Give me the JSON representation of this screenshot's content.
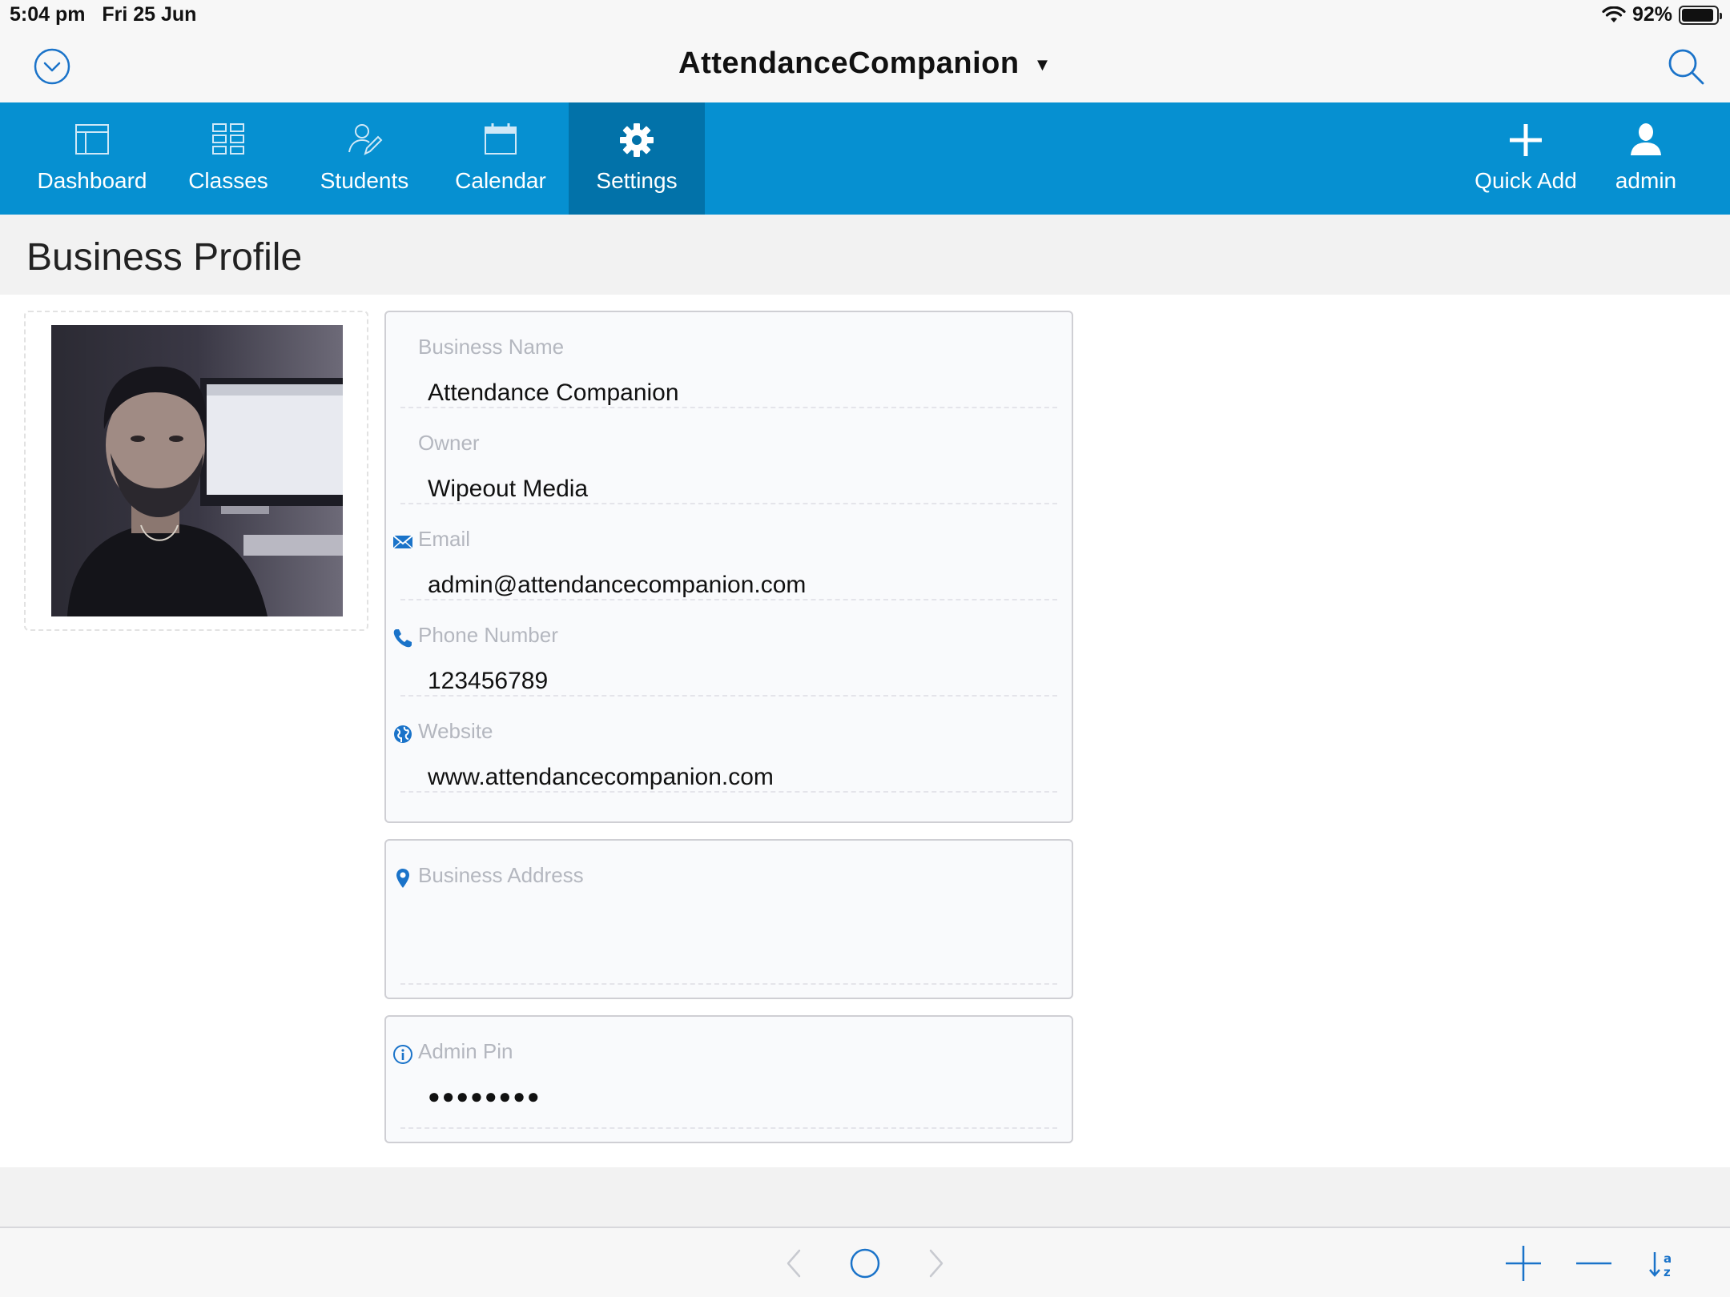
{
  "status": {
    "time": "5:04 pm",
    "date": "Fri 25 Jun",
    "battery": "92%",
    "battery_level": 0.92
  },
  "titlebar": {
    "title": "AttendanceCompanion",
    "caret": "▼"
  },
  "nav": {
    "items": [
      {
        "label": "Dashboard",
        "icon": "dashboard-icon"
      },
      {
        "label": "Classes",
        "icon": "grid-icon"
      },
      {
        "label": "Students",
        "icon": "student-icon"
      },
      {
        "label": "Calendar",
        "icon": "calendar-icon"
      },
      {
        "label": "Settings",
        "icon": "gear-icon",
        "active": true
      }
    ],
    "quick_add": {
      "label": "Quick Add",
      "icon": "plus-icon"
    },
    "user": {
      "label": "admin",
      "icon": "user-icon"
    }
  },
  "page": {
    "title": "Business Profile"
  },
  "profile": {
    "business_name": {
      "label": "Business Name",
      "value": "Attendance Companion"
    },
    "owner": {
      "label": "Owner",
      "value": "Wipeout Media"
    },
    "email": {
      "label": "Email",
      "value": "admin@attendancecompanion.com",
      "icon": "mail-icon"
    },
    "phone": {
      "label": "Phone Number",
      "value": "123456789",
      "icon": "phone-icon"
    },
    "website": {
      "label": "Website",
      "value": "www.attendancecompanion.com",
      "icon": "globe-icon"
    }
  },
  "address": {
    "label": "Business Address",
    "value": "",
    "icon": "location-pin-icon"
  },
  "pin": {
    "label": "Admin Pin",
    "value": "●●●●●●●●",
    "icon": "info-icon"
  },
  "colors": {
    "accent": "#0690d1",
    "accent_active": "#0272a9",
    "label_gray": "#b4b7bf"
  }
}
